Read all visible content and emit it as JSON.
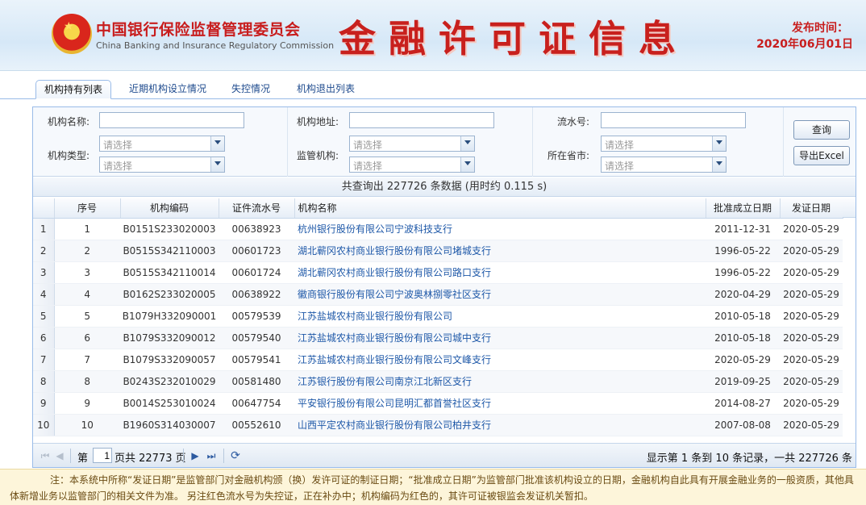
{
  "header": {
    "org_cn": "中国银行保险监督管理委员会",
    "org_en": "China Banking and Insurance Regulatory Commission",
    "title": "金融许可证信息",
    "pub_label": "发布时间：",
    "pub_date": "2020年06月01日",
    "accent_color": "#c81d1d"
  },
  "tabs": [
    {
      "label": "机构持有列表",
      "active": true
    },
    {
      "label": "近期机构设立情况",
      "active": false
    },
    {
      "label": "失控情况",
      "active": false
    },
    {
      "label": "机构退出列表",
      "active": false
    }
  ],
  "search": {
    "name_label": "机构名称:",
    "address_label": "机构地址:",
    "serial_label": "流水号:",
    "type_label": "机构类型:",
    "regulator_label": "监管机构:",
    "province_label": "所在省市:",
    "select_placeholder": "请选择",
    "query_button": "查询",
    "export_button": "导出Excel"
  },
  "summary": "共查询出 227726 条数据 (用时约 0.115 s)",
  "grid": {
    "columns": [
      "序号",
      "机构编码",
      "证件流水号",
      "机构名称",
      "批准成立日期",
      "发证日期"
    ],
    "rows": [
      {
        "rn": "1",
        "seq": "1",
        "code": "B0151S233020003",
        "serial": "00638923",
        "name": "杭州银行股份有限公司宁波科技支行",
        "approve": "2011-12-31",
        "issue": "2020-05-29"
      },
      {
        "rn": "2",
        "seq": "2",
        "code": "B0515S342110003",
        "serial": "00601723",
        "name": "湖北蕲冈农村商业银行股份有限公司堵城支行",
        "approve": "1996-05-22",
        "issue": "2020-05-29"
      },
      {
        "rn": "3",
        "seq": "3",
        "code": "B0515S342110014",
        "serial": "00601724",
        "name": "湖北蕲冈农村商业银行股份有限公司路口支行",
        "approve": "1996-05-22",
        "issue": "2020-05-29"
      },
      {
        "rn": "4",
        "seq": "4",
        "code": "B0162S233020005",
        "serial": "00638922",
        "name": "徽商银行股份有限公司宁波奥林捌零社区支行",
        "approve": "2020-04-29",
        "issue": "2020-05-29"
      },
      {
        "rn": "5",
        "seq": "5",
        "code": "B1079H332090001",
        "serial": "00579539",
        "name": "江苏盐城农村商业银行股份有限公司",
        "approve": "2010-05-18",
        "issue": "2020-05-29"
      },
      {
        "rn": "6",
        "seq": "6",
        "code": "B1079S332090012",
        "serial": "00579540",
        "name": "江苏盐城农村商业银行股份有限公司城中支行",
        "approve": "2010-05-18",
        "issue": "2020-05-29"
      },
      {
        "rn": "7",
        "seq": "7",
        "code": "B1079S332090057",
        "serial": "00579541",
        "name": "江苏盐城农村商业银行股份有限公司文峰支行",
        "approve": "2020-05-29",
        "issue": "2020-05-29"
      },
      {
        "rn": "8",
        "seq": "8",
        "code": "B0243S232010029",
        "serial": "00581480",
        "name": "江苏银行股份有限公司南京江北新区支行",
        "approve": "2019-09-25",
        "issue": "2020-05-29"
      },
      {
        "rn": "9",
        "seq": "9",
        "code": "B0014S253010024",
        "serial": "00647754",
        "name": "平安银行股份有限公司昆明汇都首誉社区支行",
        "approve": "2014-08-27",
        "issue": "2020-05-29"
      },
      {
        "rn": "10",
        "seq": "10",
        "code": "B1960S314030007",
        "serial": "00552610",
        "name": "山西平定农村商业银行股份有限公司柏井支行",
        "approve": "2007-08-08",
        "issue": "2020-05-29"
      }
    ]
  },
  "pager": {
    "page_prefix": "第",
    "page_value": "1",
    "page_suffix": "页共 22773 页",
    "display_info": "显示第 1 条到 10 条记录，一共 227726 条"
  },
  "note": "注：本系统中所称“发证日期”是监管部门对金融机构颁（换）发许可证的制证日期；“批准成立日期”为监管部门批准该机构设立的日期，金融机构自此具有开展金融业务的一般资质，其他具体新增业务以监管部门的相关文件为准。 另注红色流水号为失控证，正在补办中；机构编码为红色的，其许可证被银监会发证机关暂扣。",
  "icons": {
    "first": "first-page-icon",
    "prev": "prev-page-icon",
    "next": "next-page-icon",
    "last": "last-page-icon",
    "refresh": "refresh-icon",
    "dropdown": "chevron-down-icon",
    "emblem": "national-emblem-icon"
  }
}
